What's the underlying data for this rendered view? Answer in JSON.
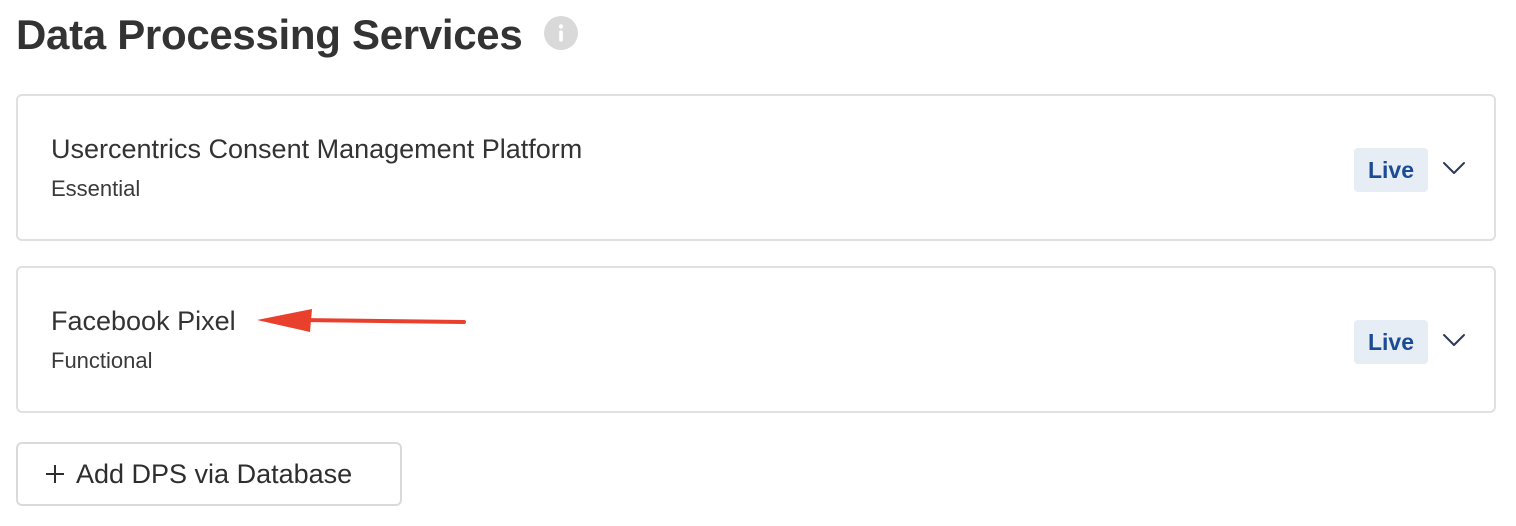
{
  "header": {
    "title": "Data Processing Services",
    "info_icon": "info-icon"
  },
  "services": [
    {
      "name": "Usercentrics Consent Management Platform",
      "category": "Essential",
      "status": "Live"
    },
    {
      "name": "Facebook Pixel",
      "category": "Functional",
      "status": "Live"
    }
  ],
  "actions": {
    "add_label": "Add DPS via Database",
    "add_icon": "plus-icon"
  },
  "colors": {
    "badge_bg": "#e6edf5",
    "badge_text": "#1b4b94",
    "annotation_arrow": "#e8402d"
  }
}
